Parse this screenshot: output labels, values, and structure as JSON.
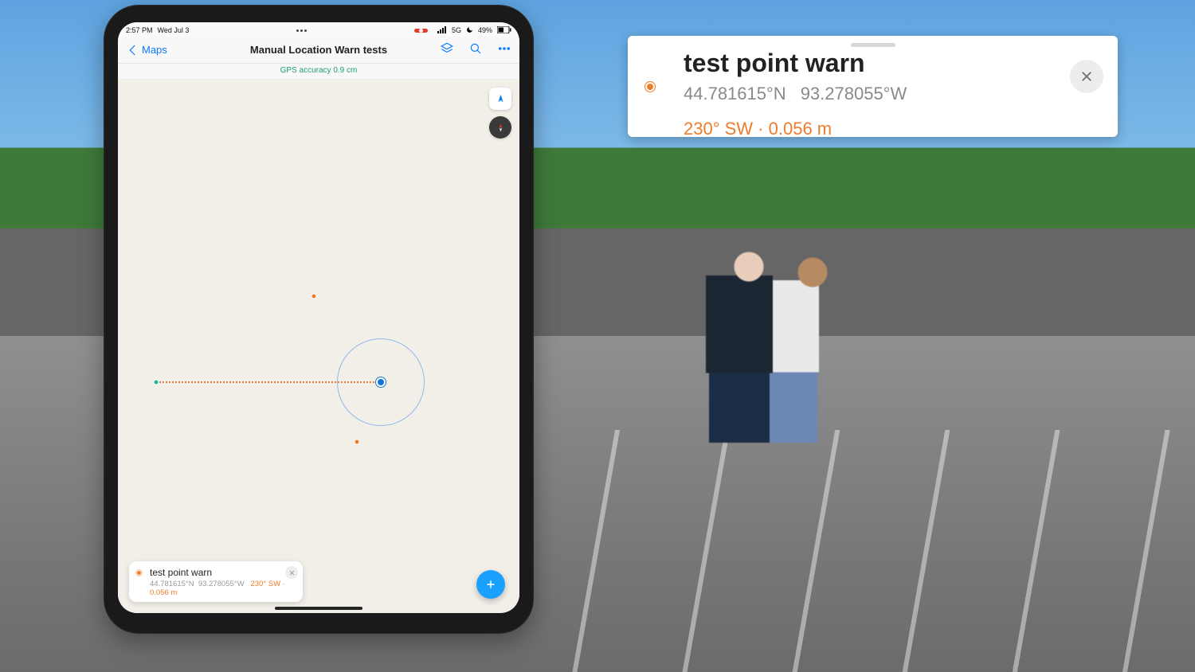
{
  "status": {
    "time": "2:57 PM",
    "date": "Wed Jul 3",
    "network": "5G",
    "battery": "49%"
  },
  "nav": {
    "back_label": "Maps",
    "title": "Manual Location Warn tests"
  },
  "accuracy": "GPS accuracy 0.9 cm",
  "feature": {
    "title": "test point warn",
    "lat": "44.781615°N",
    "lon": "93.278055°W",
    "bearing": "230° SW",
    "distance": "0.056 m"
  }
}
